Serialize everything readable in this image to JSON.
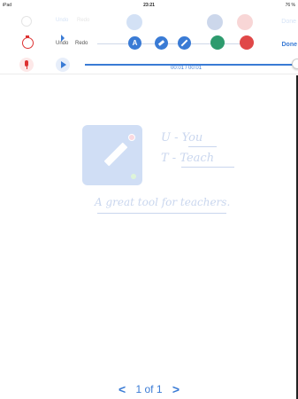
{
  "status_bar": {
    "device": "iPad",
    "time": "23:21",
    "battery": "76 %"
  },
  "ghost_toolbar": {
    "undo_label": "Undo",
    "redo_label": "Redo",
    "done_label": "Done"
  },
  "toolbar": {
    "undo_label": "Undo",
    "redo_label": "Redo",
    "text_tool_label": "A",
    "done_label": "Done",
    "colors": {
      "accent": "#3a7bd5",
      "swatch_green": "#2e9b6e",
      "swatch_red": "#e04848"
    }
  },
  "playback": {
    "time": "00:01 / 00:01",
    "progress": 1.0
  },
  "splash": {
    "line1": "U - You",
    "line2": "T - Teach",
    "tagline": "A great tool for teachers."
  },
  "pager": {
    "prev_label": "<",
    "count": "1 of 1",
    "next_label": ">"
  }
}
